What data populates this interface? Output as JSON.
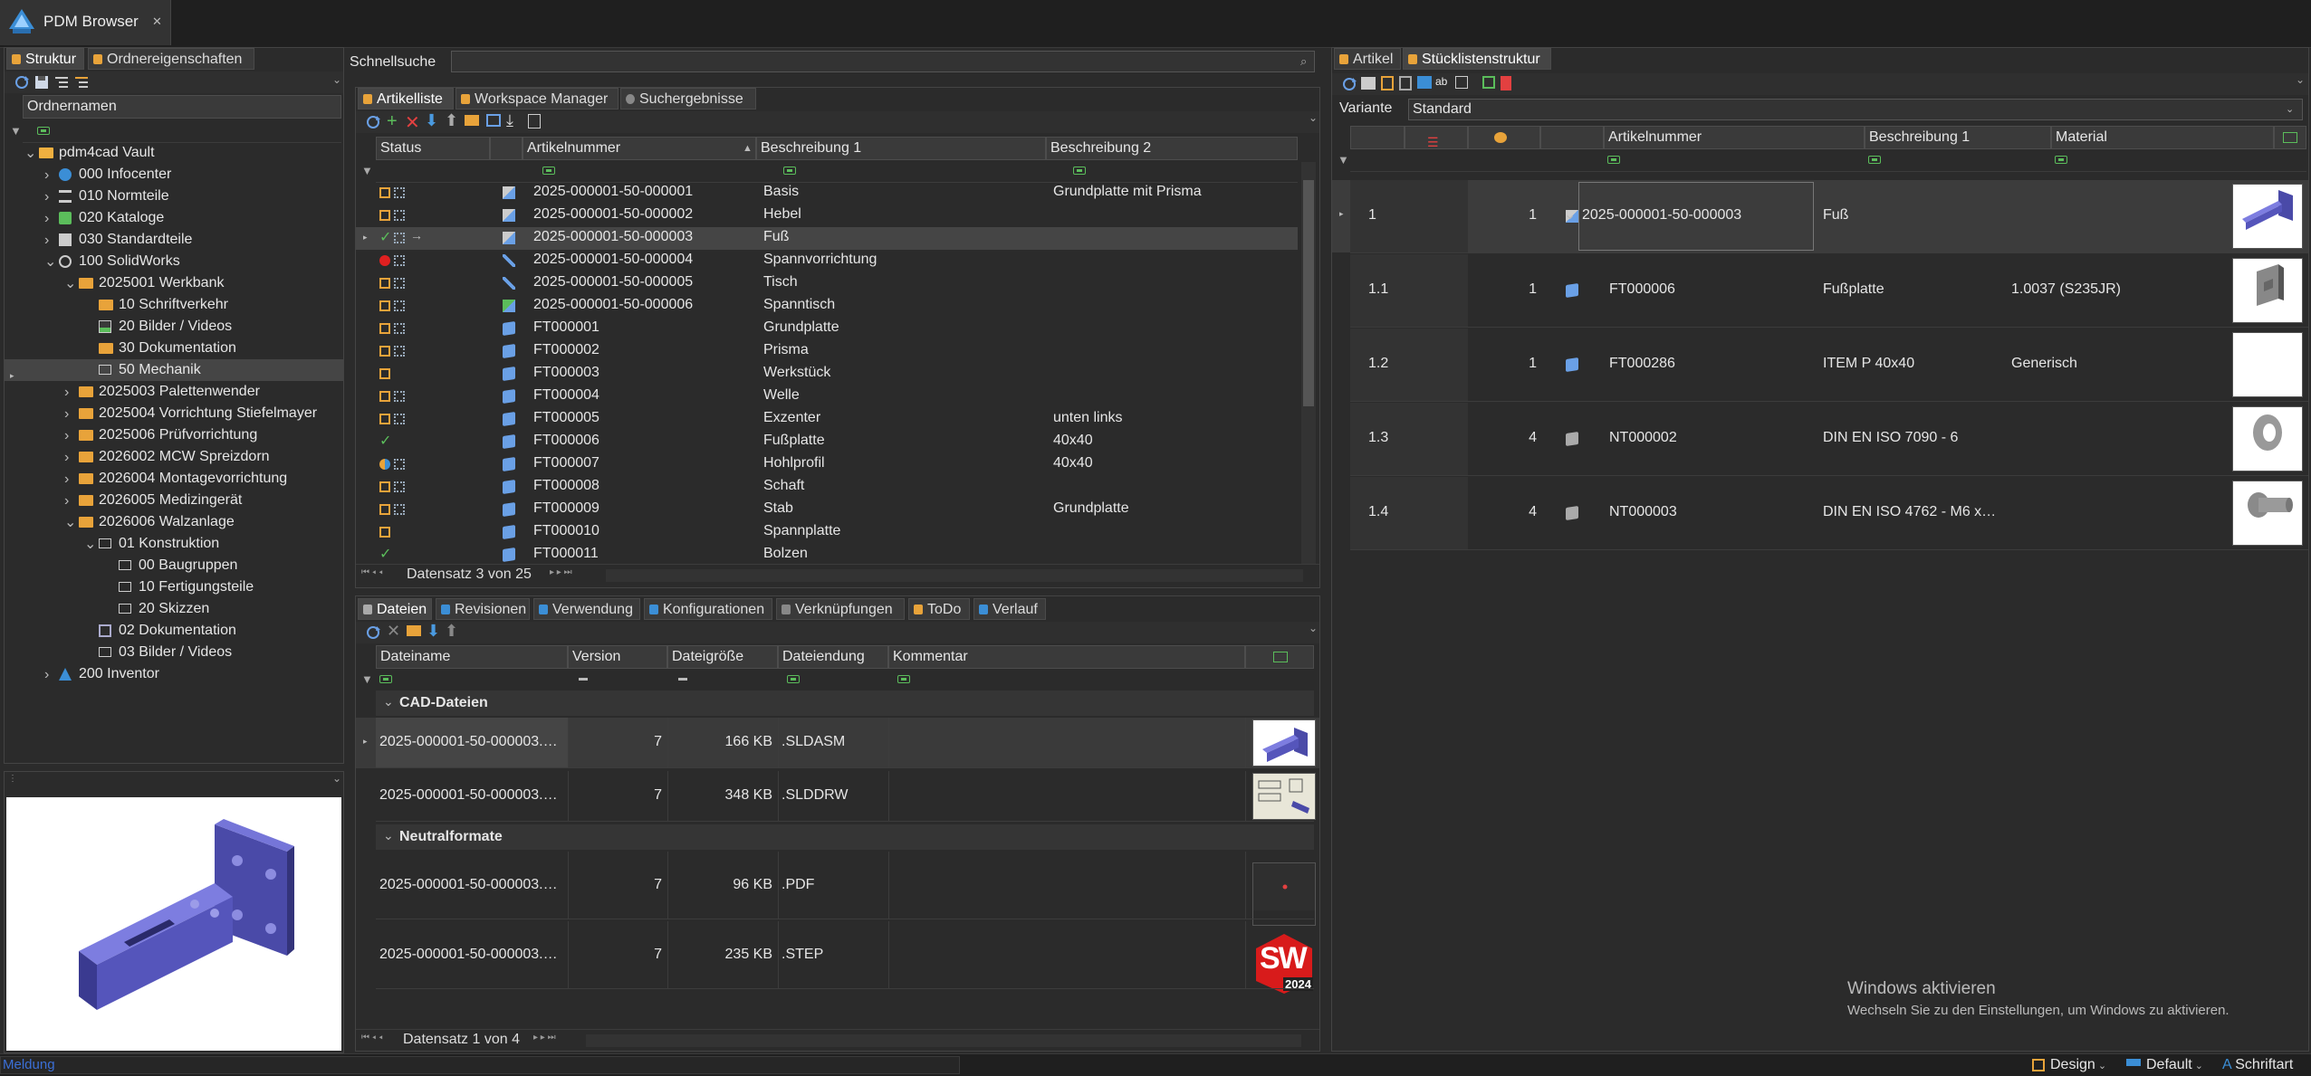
{
  "app": {
    "tab_title": "PDM Browser"
  },
  "left": {
    "tabs": [
      "Struktur",
      "Ordnereigenschaften"
    ],
    "column_header": "Ordnernamen",
    "tree": [
      {
        "label": "pdm4cad Vault",
        "lvl": 0,
        "exp": "v",
        "icon": "vault"
      },
      {
        "label": "000 Infocenter",
        "lvl": 1,
        "exp": ">",
        "icon": "info"
      },
      {
        "label": "010 Normteile",
        "lvl": 1,
        "exp": ">",
        "icon": "list"
      },
      {
        "label": "020 Kataloge",
        "lvl": 1,
        "exp": ">",
        "icon": "catalog"
      },
      {
        "label": "030 Standardteile",
        "lvl": 1,
        "exp": ">",
        "icon": "std"
      },
      {
        "label": "100 SolidWorks",
        "lvl": 1,
        "exp": "v",
        "icon": "sw"
      },
      {
        "label": "2025001 Werkbank",
        "lvl": 2,
        "exp": "v",
        "icon": "project"
      },
      {
        "label": "10 Schriftverkehr",
        "lvl": 3,
        "exp": "",
        "icon": "folder"
      },
      {
        "label": "20 Bilder / Videos",
        "lvl": 3,
        "exp": "",
        "icon": "image"
      },
      {
        "label": "30 Dokumentation",
        "lvl": 3,
        "exp": "",
        "icon": "folder"
      },
      {
        "label": "50 Mechanik",
        "lvl": 3,
        "exp": "",
        "icon": "mech",
        "selected": true
      },
      {
        "label": "2025003 Palettenwender",
        "lvl": 2,
        "exp": ">",
        "icon": "project"
      },
      {
        "label": "2025004 Vorrichtung Stiefelmayer",
        "lvl": 2,
        "exp": ">",
        "icon": "project"
      },
      {
        "label": "2025006 Prüfvorrichtung",
        "lvl": 2,
        "exp": ">",
        "icon": "project"
      },
      {
        "label": "2026002 MCW Spreizdorn",
        "lvl": 2,
        "exp": ">",
        "icon": "project"
      },
      {
        "label": "2026004 Montagevorrichtung",
        "lvl": 2,
        "exp": ">",
        "icon": "project"
      },
      {
        "label": "2026005 Medizingerät",
        "lvl": 2,
        "exp": ">",
        "icon": "project"
      },
      {
        "label": "2026006 Walzanlage",
        "lvl": 2,
        "exp": "v",
        "icon": "project"
      },
      {
        "label": "01 Konstruktion",
        "lvl": 3,
        "exp": "v",
        "icon": "mech"
      },
      {
        "label": "00 Baugruppen",
        "lvl": 4,
        "exp": "",
        "icon": "mech"
      },
      {
        "label": "10 Fertigungsteile",
        "lvl": 4,
        "exp": "",
        "icon": "mech"
      },
      {
        "label": "20 Skizzen",
        "lvl": 4,
        "exp": "",
        "icon": "mech"
      },
      {
        "label": "02 Dokumentation",
        "lvl": 3,
        "exp": "",
        "icon": "doc"
      },
      {
        "label": "03 Bilder / Videos",
        "lvl": 3,
        "exp": "",
        "icon": "mech"
      },
      {
        "label": "200 Inventor",
        "lvl": 1,
        "exp": ">",
        "icon": "inventor"
      }
    ]
  },
  "middle": {
    "search_label": "Schnellsuche",
    "search_value": "",
    "tabs": [
      "Artikelliste",
      "Workspace Manager",
      "Suchergebnisse"
    ],
    "columns": [
      "Status",
      "Artikelnummer",
      "Beschreibung 1",
      "Beschreibung 2"
    ],
    "rows": [
      {
        "status": "pending",
        "type": "asm",
        "num": "2025-000001-50-000001",
        "b1": "Basis",
        "b2": "Grundplatte mit Prisma"
      },
      {
        "status": "pending",
        "type": "asm",
        "num": "2025-000001-50-000002",
        "b1": "Hebel",
        "b2": ""
      },
      {
        "status": "ok",
        "type": "asm",
        "num": "2025-000001-50-000003",
        "b1": "Fuß",
        "b2": "",
        "selected": true
      },
      {
        "status": "red",
        "type": "tool",
        "num": "2025-000001-50-000004",
        "b1": "Spannvorrichtung",
        "b2": ""
      },
      {
        "status": "pending",
        "type": "tool",
        "num": "2025-000001-50-000005",
        "b1": "Tisch",
        "b2": ""
      },
      {
        "status": "pending",
        "type": "asm2",
        "num": "2025-000001-50-000006",
        "b1": "Spanntisch",
        "b2": ""
      },
      {
        "status": "pending",
        "type": "part",
        "num": "FT000001",
        "b1": "Grundplatte",
        "b2": ""
      },
      {
        "status": "pending",
        "type": "part",
        "num": "FT000002",
        "b1": "Prisma",
        "b2": ""
      },
      {
        "status": "pending1",
        "type": "part",
        "num": "FT000003",
        "b1": "Werkstück",
        "b2": ""
      },
      {
        "status": "pending",
        "type": "part",
        "num": "FT000004",
        "b1": "Welle",
        "b2": ""
      },
      {
        "status": "pending",
        "type": "part",
        "num": "FT000005",
        "b1": "Exzenter",
        "b2": "unten links"
      },
      {
        "status": "check",
        "type": "part",
        "num": "FT000006",
        "b1": "Fußplatte",
        "b2": "40x40"
      },
      {
        "status": "half",
        "type": "part",
        "num": "FT000007",
        "b1": "Hohlprofil",
        "b2": "40x40"
      },
      {
        "status": "pending",
        "type": "part",
        "num": "FT000008",
        "b1": "Schaft",
        "b2": ""
      },
      {
        "status": "pending",
        "type": "part",
        "num": "FT000009",
        "b1": "Stab",
        "b2": "Grundplatte"
      },
      {
        "status": "pending1",
        "type": "part",
        "num": "FT000010",
        "b1": "Spannplatte",
        "b2": ""
      },
      {
        "status": "check",
        "type": "part",
        "num": "FT000011",
        "b1": "Bolzen",
        "b2": ""
      }
    ],
    "record_text": "Datensatz 3 von 25"
  },
  "files": {
    "tabs": [
      "Dateien",
      "Revisionen",
      "Verwendung",
      "Konfigurationen",
      "Verknüpfungen",
      "ToDo",
      "Verlauf"
    ],
    "columns": [
      "Dateiname",
      "Version",
      "Dateigröße",
      "Dateiendung",
      "Kommentar"
    ],
    "groups": [
      {
        "name": "CAD-Dateien",
        "files": [
          {
            "name": "2025-000001-50-000003.…",
            "version": "7",
            "size": "166 KB",
            "ext": ".SLDASM",
            "comment": "",
            "thumb": "asm"
          },
          {
            "name": "2025-000001-50-000003.…",
            "version": "7",
            "size": "348 KB",
            "ext": ".SLDDRW",
            "comment": "",
            "thumb": "drw"
          }
        ]
      },
      {
        "name": "Neutralformate",
        "files": [
          {
            "name": "2025-000001-50-000003.…",
            "version": "7",
            "size": "96 KB",
            "ext": ".PDF",
            "comment": "",
            "thumb": "pdf"
          },
          {
            "name": "2025-000001-50-000003.…",
            "version": "7",
            "size": "235 KB",
            "ext": ".STEP",
            "comment": "",
            "thumb": "sw"
          }
        ]
      }
    ],
    "sw_logo_text": "SW",
    "sw_year": "2024",
    "record_text": "Datensatz 1 von 4"
  },
  "right": {
    "tabs": [
      "Artikel",
      "Stücklistenstruktur"
    ],
    "variant_label": "Variante",
    "variant_value": "Standard",
    "columns": [
      "Artikelnummer",
      "Beschreibung 1",
      "Material"
    ],
    "rows": [
      {
        "pos": "1",
        "qty": "1",
        "num": "2025-000001-50-000003",
        "b1": "Fuß",
        "mat": "",
        "type": "asm",
        "thumb": "asm",
        "root": true
      },
      {
        "pos": "1.1",
        "qty": "1",
        "num": "FT000006",
        "b1": "Fußplatte",
        "mat": "1.0037 (S235JR)",
        "type": "part",
        "thumb": "plate"
      },
      {
        "pos": "1.2",
        "qty": "1",
        "num": "FT000286",
        "b1": "ITEM P 40x40",
        "mat": "Generisch",
        "type": "part",
        "thumb": "blank"
      },
      {
        "pos": "1.3",
        "qty": "4",
        "num": "NT000002",
        "b1": "DIN EN ISO 7090 - 6",
        "mat": "",
        "type": "norm",
        "thumb": "washer"
      },
      {
        "pos": "1.4",
        "qty": "4",
        "num": "NT000003",
        "b1": "DIN EN ISO 4762 - M6 x…",
        "mat": "",
        "type": "norm",
        "thumb": "screw"
      }
    ]
  },
  "watermark": {
    "title": "Windows aktivieren",
    "text": "Wechseln Sie zu den Einstellungen, um Windows zu aktivieren."
  },
  "statusbar": {
    "left": "Meldung",
    "design": "Design",
    "default": "Default",
    "font": "Schriftart"
  },
  "colors": {
    "accent": "#6aa0e6",
    "folder": "#e8a33a",
    "ok": "#5bbd5b",
    "error": "#e02020",
    "selection": "#454545"
  }
}
